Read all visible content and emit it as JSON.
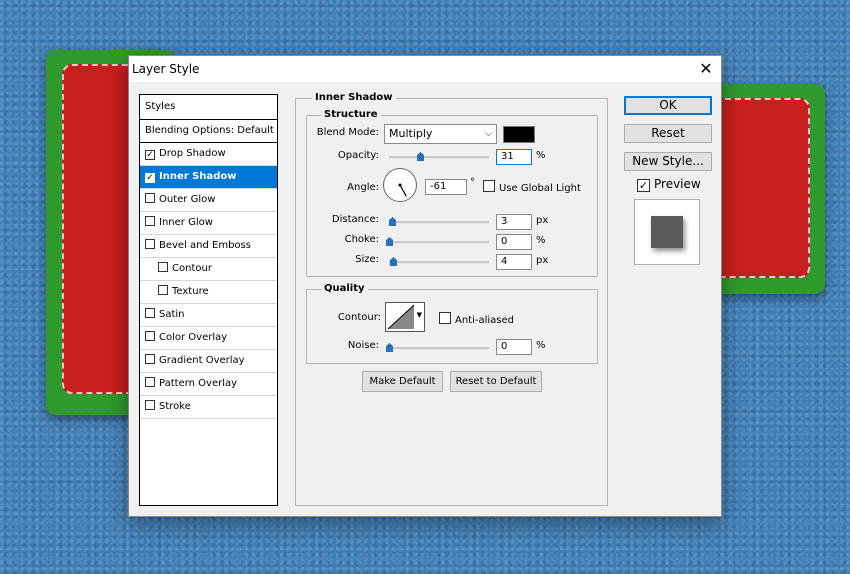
{
  "dialog": {
    "title": "Layer Style",
    "close_glyph": "✕"
  },
  "styles_panel": {
    "header": "Styles",
    "blending_options": "Blending Options: Default",
    "items": [
      {
        "label": "Drop Shadow",
        "checked": true,
        "active": false,
        "sub": false
      },
      {
        "label": "Inner Shadow",
        "checked": true,
        "active": true,
        "sub": false
      },
      {
        "label": "Outer Glow",
        "checked": false,
        "active": false,
        "sub": false
      },
      {
        "label": "Inner Glow",
        "checked": false,
        "active": false,
        "sub": false
      },
      {
        "label": "Bevel and Emboss",
        "checked": false,
        "active": false,
        "sub": false
      },
      {
        "label": "Contour",
        "checked": false,
        "active": false,
        "sub": true
      },
      {
        "label": "Texture",
        "checked": false,
        "active": false,
        "sub": true
      },
      {
        "label": "Satin",
        "checked": false,
        "active": false,
        "sub": false
      },
      {
        "label": "Color Overlay",
        "checked": false,
        "active": false,
        "sub": false
      },
      {
        "label": "Gradient Overlay",
        "checked": false,
        "active": false,
        "sub": false
      },
      {
        "label": "Pattern Overlay",
        "checked": false,
        "active": false,
        "sub": false
      },
      {
        "label": "Stroke",
        "checked": false,
        "active": false,
        "sub": false
      }
    ]
  },
  "inner_shadow": {
    "section_title": "Inner Shadow",
    "structure_title": "Structure",
    "blend_mode": {
      "label": "Blend Mode:",
      "value": "Multiply",
      "color": "#000000"
    },
    "opacity": {
      "label": "Opacity:",
      "value": "31",
      "unit": "%",
      "level": 0.31
    },
    "angle": {
      "label": "Angle:",
      "value": "-61",
      "unit": "°",
      "degrees": -61,
      "use_global_light": "Use Global Light",
      "use_global_light_checked": false
    },
    "distance": {
      "label": "Distance:",
      "value": "3",
      "unit": "px",
      "level": 0.03
    },
    "choke": {
      "label": "Choke:",
      "value": "0",
      "unit": "%",
      "level": 0.0
    },
    "size": {
      "label": "Size:",
      "value": "4",
      "unit": "px",
      "level": 0.04
    },
    "quality_title": "Quality",
    "contour": {
      "label": "Contour:",
      "anti_aliased": "Anti-aliased",
      "anti_aliased_checked": false
    },
    "noise": {
      "label": "Noise:",
      "value": "0",
      "unit": "%",
      "level": 0.0
    },
    "make_default": "Make Default",
    "reset_default": "Reset to Default"
  },
  "actions": {
    "ok": "OK",
    "reset": "Reset",
    "new_style": "New Style...",
    "preview_label": "Preview",
    "preview_checked": true
  },
  "colors": {
    "accent": "#0078d7",
    "background_felt_blue": "#3f7fb8",
    "felt_green": "#2f9a2d",
    "felt_red": "#c81f1f"
  }
}
